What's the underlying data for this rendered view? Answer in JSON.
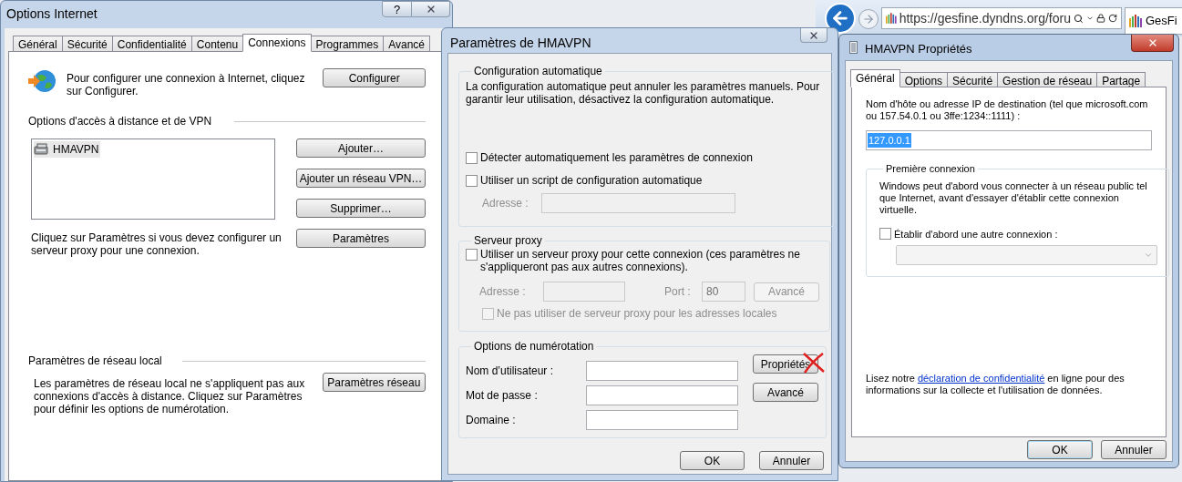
{
  "background_browser": {
    "address": "https://gesfine.dyndns.org/foru",
    "tab_title": "GesFi"
  },
  "internet_options": {
    "title": "Options Internet",
    "help": "?",
    "tabs": [
      {
        "label": "Général",
        "selected": false
      },
      {
        "label": "Sécurité",
        "selected": false
      },
      {
        "label": "Confidentialité",
        "selected": false
      },
      {
        "label": "Contenu",
        "selected": false
      },
      {
        "label": "Connexions",
        "selected": true
      },
      {
        "label": "Programmes",
        "selected": false
      },
      {
        "label": "Avancé",
        "selected": false
      }
    ],
    "setup": {
      "text": "Pour configurer une connexion à Internet, cliquez sur Configurer.",
      "button": "Configurer"
    },
    "vpn": {
      "heading": "Options d'accès à distance et de VPN",
      "connections": [
        {
          "name": "HMAVPN",
          "selected": true
        }
      ],
      "buttons": [
        "Ajouter…",
        "Ajouter un réseau VPN…",
        "Supprimer…"
      ],
      "note": "Cliquez sur Paramètres si vous devez configurer un serveur proxy pour une connexion.",
      "settings_button": "Paramètres"
    },
    "lan": {
      "heading": "Paramètres de réseau local",
      "text": "Les paramètres de réseau local ne s'appliquent pas aux connexions d'accès à distance. Cliquez sur Paramètres pour définir les options de numérotation.",
      "button": "Paramètres réseau"
    }
  },
  "vpn_settings": {
    "title": "Paramètres de HMAVPN",
    "auto_config": {
      "legend": "Configuration automatique",
      "text": "La configuration automatique peut annuler les paramètres manuels. Pour garantir leur utilisation, désactivez la configuration automatique.",
      "checkboxes": [
        {
          "label": "Détecter automatiquement les paramètres de connexion",
          "checked": false
        },
        {
          "label": "Utiliser un script de configuration automatique",
          "checked": false
        }
      ],
      "address": {
        "label": "Adresse :",
        "disabled": true
      }
    },
    "proxy": {
      "legend": "Serveur proxy",
      "checkbox": {
        "label": "Utiliser un serveur proxy pour cette connexion (ces paramètres ne s'appliqueront pas aux autres connexions).",
        "checked": false
      },
      "address": {
        "label": "Adresse :",
        "disabled": true
      },
      "port": {
        "label": "Port :",
        "value": "80",
        "disabled": true
      },
      "advanced": {
        "label": "Avancé",
        "disabled": true
      },
      "bypass": {
        "label": "Ne pas utiliser de serveur proxy pour les adresses locales",
        "checked": false,
        "disabled": true
      }
    },
    "dial": {
      "legend": "Options de numérotation",
      "fields": [
        {
          "label": "Nom d’utilisateur :"
        },
        {
          "label": "Mot de passe :"
        },
        {
          "label": "Domaine :"
        }
      ],
      "buttons": [
        {
          "label": "Propriétés",
          "crossed_out": true
        },
        {
          "label": "Avancé",
          "crossed_out": false
        }
      ]
    },
    "buttons": [
      "OK",
      "Annuler"
    ]
  },
  "vpn_properties": {
    "title": "HMAVPN Propriétés",
    "tabs": [
      {
        "label": "Général",
        "selected": true
      },
      {
        "label": "Options",
        "selected": false
      },
      {
        "label": "Sécurité",
        "selected": false
      },
      {
        "label": "Gestion de réseau",
        "selected": false
      },
      {
        "label": "Partage",
        "selected": false
      }
    ],
    "host": {
      "label": "Nom d'hôte ou adresse IP de destination (tel que microsoft.com ou 157.54.0.1 ou 3ffe:1234::1111) :",
      "value": "127.0.0.1",
      "selected": true
    },
    "first_connection": {
      "legend": "Première connexion",
      "text": "Windows peut d'abord vous connecter à un réseau public tel que Internet, avant d'essayer d'établir cette connexion virtuelle.",
      "checkbox": {
        "label": "Établir d'abord une autre connexion :",
        "checked": false
      },
      "dropdown": {
        "disabled": true
      }
    },
    "privacy": {
      "before": "Lisez notre ",
      "link": "déclaration de confidentialité",
      "after": " en ligne pour des informations sur la collecte et l'utilisation de données."
    },
    "buttons": [
      {
        "label": "OK",
        "default": true
      },
      {
        "label": "Annuler",
        "default": false
      }
    ]
  }
}
